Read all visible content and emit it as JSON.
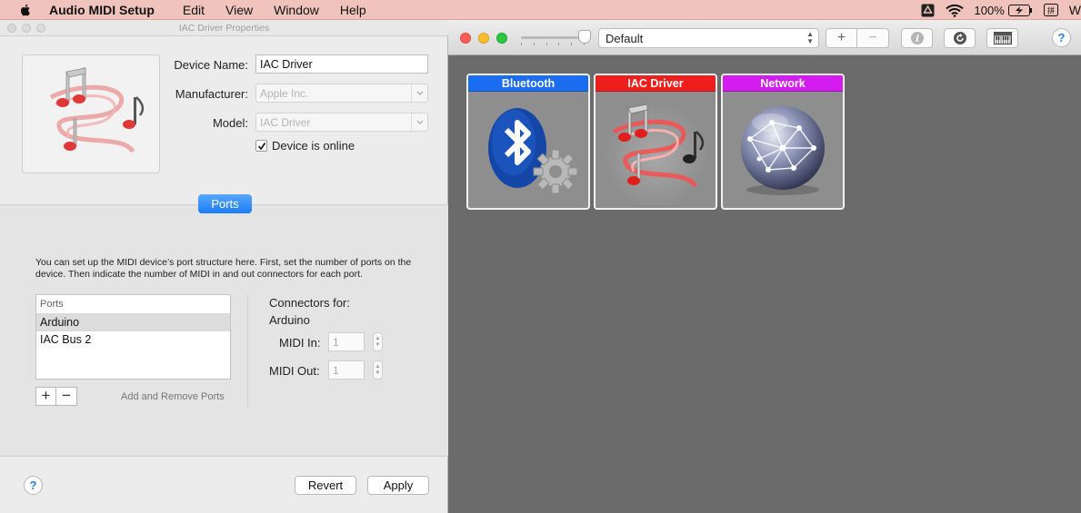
{
  "menubar": {
    "app_name": "Audio MIDI Setup",
    "items": [
      "Edit",
      "View",
      "Window",
      "Help"
    ],
    "battery": "100%",
    "trailing": "W"
  },
  "props_window": {
    "title": "IAC Driver Properties",
    "device_name_label": "Device Name:",
    "device_name_value": "IAC Driver",
    "manufacturer_label": "Manufacturer:",
    "manufacturer_value": "Apple Inc.",
    "model_label": "Model:",
    "model_value": "IAC Driver",
    "online_label": "Device is online",
    "online_checked": true,
    "ports_tab": "Ports",
    "instructions": "You can set up the MIDI device’s port structure here. First, set the number of ports on the device. Then indicate the number of MIDI in and out connectors for each port.",
    "ports_header": "Ports",
    "ports": [
      {
        "name": "Arduino",
        "selected": true
      },
      {
        "name": "IAC Bus 2",
        "selected": false
      }
    ],
    "add_symbol": "+",
    "remove_symbol": "−",
    "add_remove_label": "Add and Remove Ports",
    "connectors_for": "Connectors for:",
    "connectors_port": "Arduino",
    "midi_in_label": "MIDI In:",
    "midi_in_value": "1",
    "midi_out_label": "MIDI Out:",
    "midi_out_value": "1",
    "help_symbol": "?",
    "revert_label": "Revert",
    "apply_label": "Apply"
  },
  "midi_window": {
    "configuration": "Default",
    "add_symbol": "+",
    "remove_symbol": "−",
    "help_symbol": "?",
    "devices": [
      {
        "label": "Bluetooth",
        "color": "#1a6cf0",
        "icon": "bluetooth-gear-icon"
      },
      {
        "label": "IAC Driver",
        "color": "#f01d1d",
        "icon": "music-notes-icon"
      },
      {
        "label": "Network",
        "color": "#d51cf0",
        "icon": "network-globe-icon"
      }
    ]
  },
  "colors": {
    "accent_blue": "#1a7cf5",
    "desktop": "#f5b0a8",
    "canvas": "#6b6b6b"
  }
}
